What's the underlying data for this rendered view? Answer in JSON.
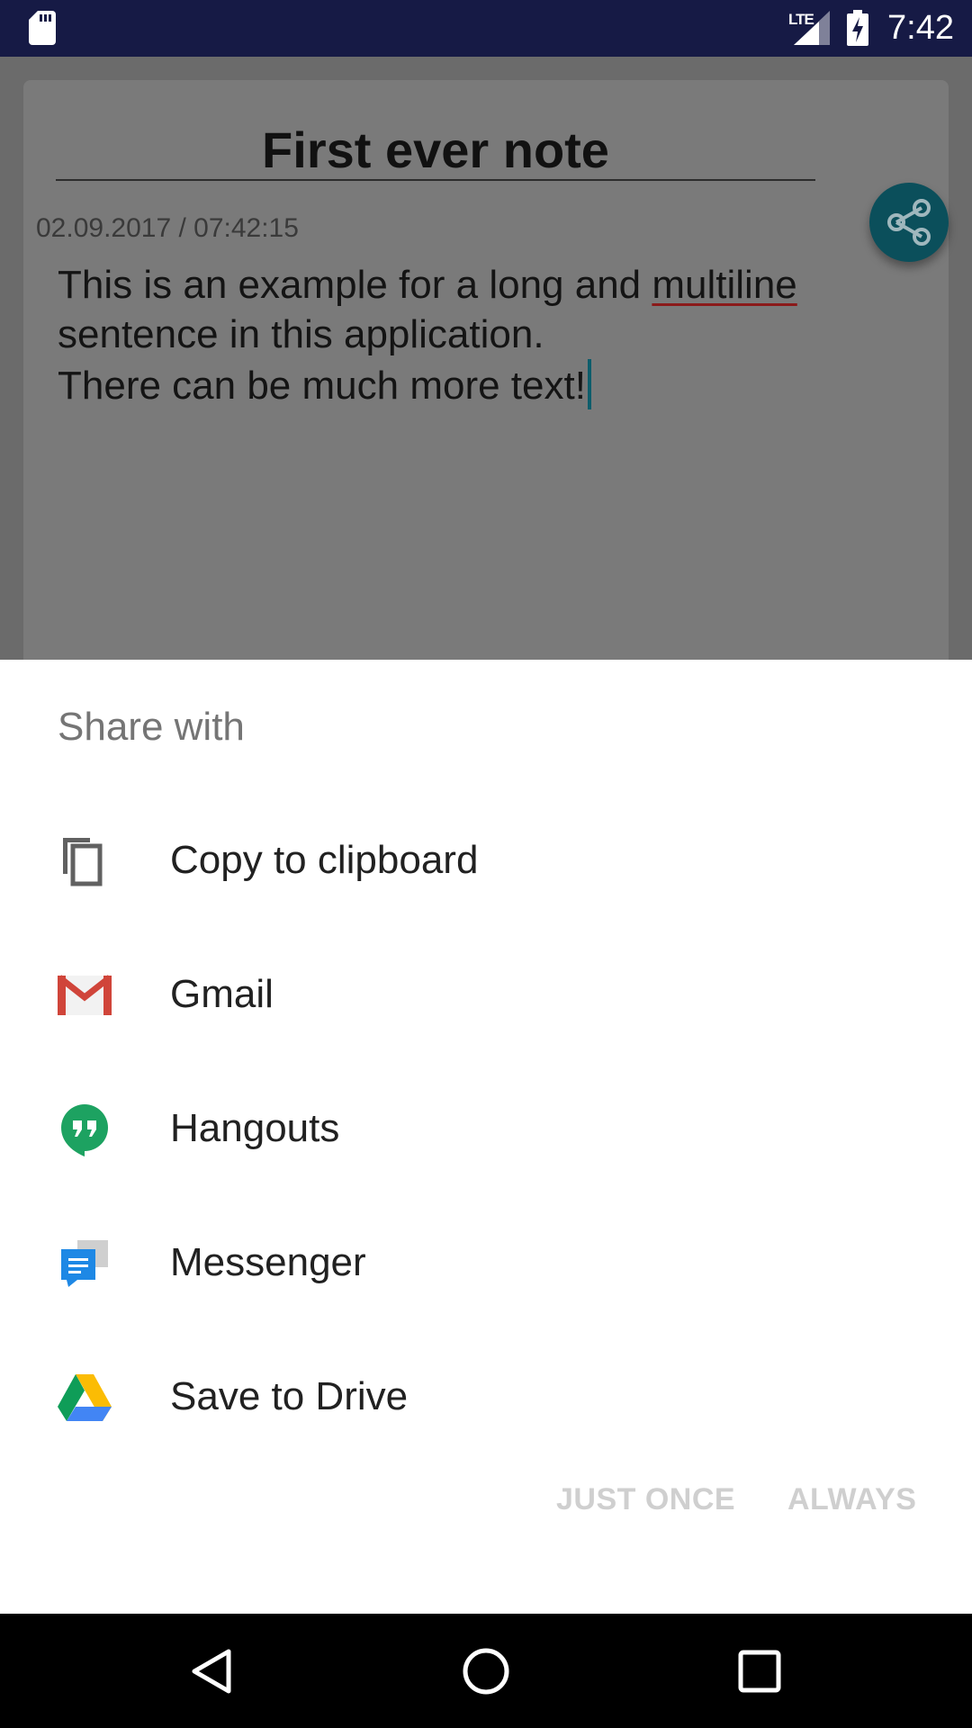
{
  "status_bar": {
    "network_label": "LTE",
    "time": "7:42",
    "icons": [
      "sd-card-icon",
      "signal-icon",
      "battery-charging-icon"
    ]
  },
  "note": {
    "title": "First ever note",
    "timestamp": "02.09.2017 / 07:42:15",
    "body_line1_before": "This is an example for a long and ",
    "body_line1_flagged_word": "multiline",
    "body_line2": "sentence in this application.",
    "body_line3": "There can be much more text!",
    "share_fab_icon": "share-icon"
  },
  "share_sheet": {
    "title": "Share with",
    "items": [
      {
        "label": "Copy to clipboard",
        "icon": "copy-icon"
      },
      {
        "label": "Gmail",
        "icon": "gmail-icon"
      },
      {
        "label": "Hangouts",
        "icon": "hangouts-icon"
      },
      {
        "label": "Messenger",
        "icon": "messenger-icon"
      },
      {
        "label": "Save to Drive",
        "icon": "drive-icon"
      }
    ],
    "just_once_label": "JUST ONCE",
    "always_label": "ALWAYS"
  },
  "nav_bar": {
    "icons": [
      "back-icon",
      "home-icon",
      "recents-icon"
    ]
  },
  "colors": {
    "status_bar": "#161a45",
    "accent": "#0b4f5b",
    "disabled_button": "#cfcfcf"
  }
}
